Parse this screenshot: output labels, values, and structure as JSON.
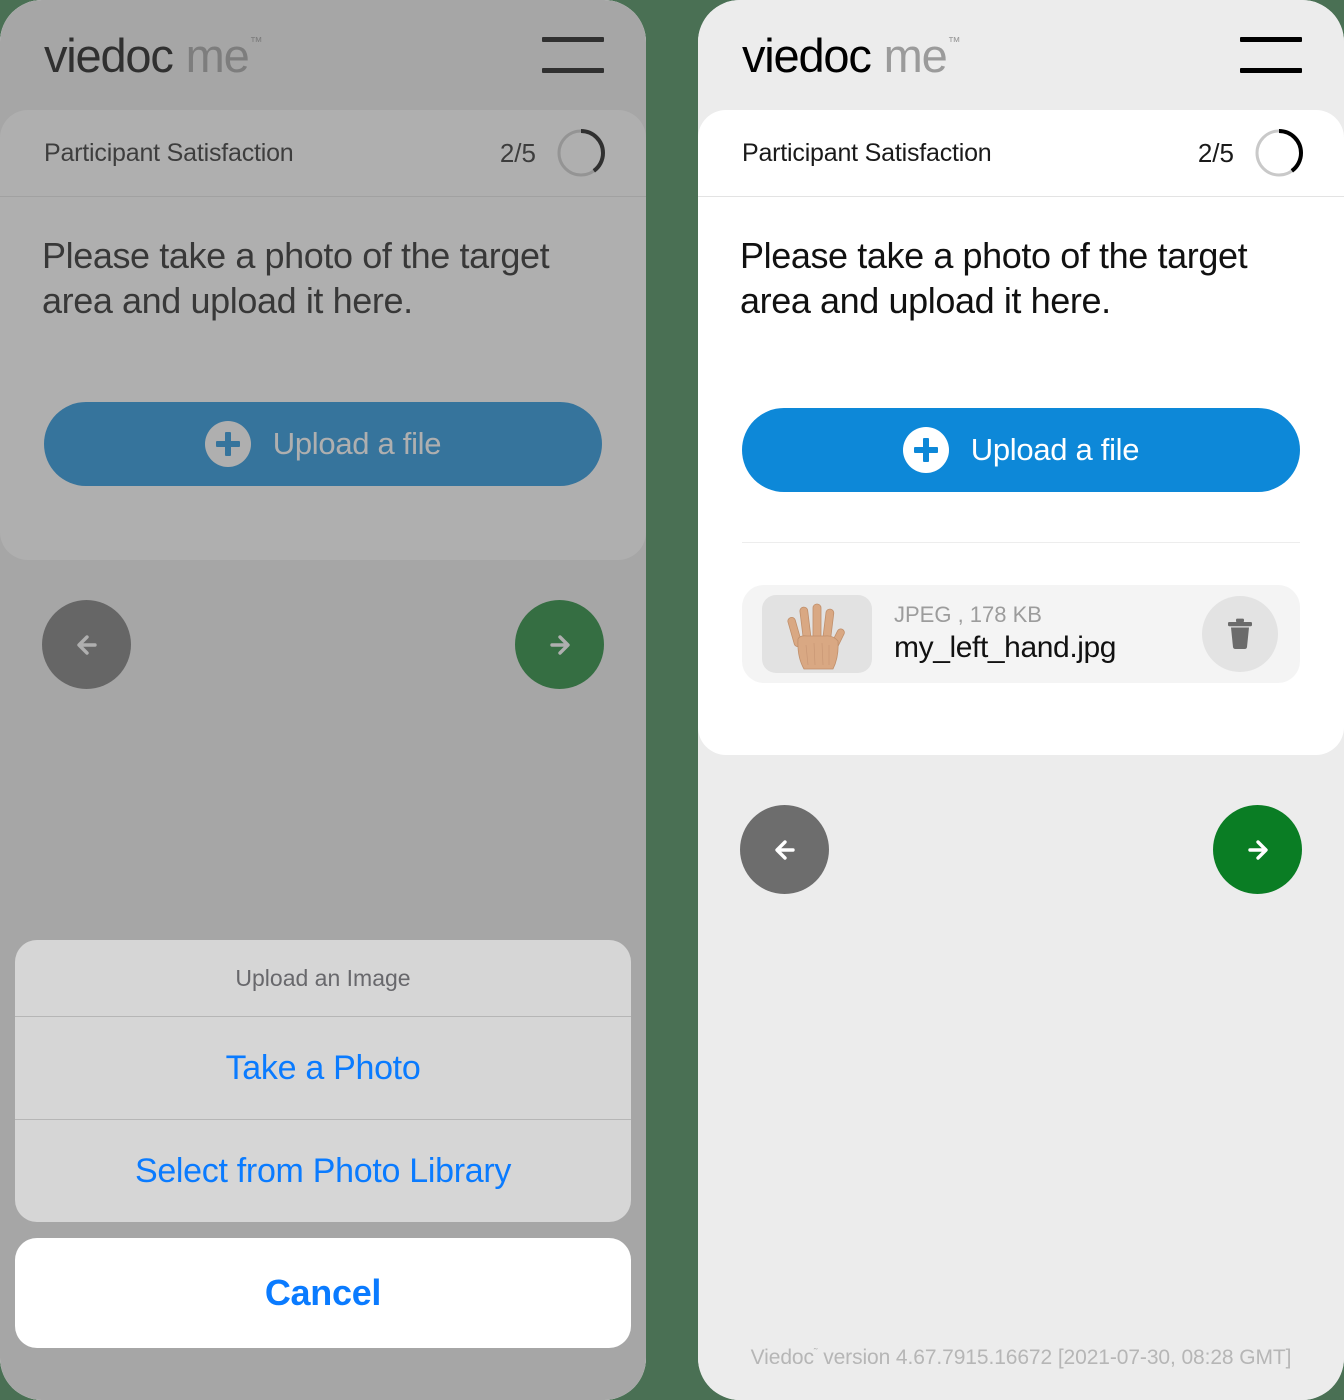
{
  "brand": {
    "name": "viedoc",
    "suffix": "me",
    "trademark": "™"
  },
  "colors": {
    "page_background": "#4a7054",
    "app_background": "#ececec",
    "card_background": "#ffffff",
    "accent_blue": "#0d88d8",
    "ios_blue": "#0a7bff",
    "next_green": "#0a7d24",
    "prev_gray": "#6d6d6d",
    "file_row": "#f4f4f4",
    "sheet_gray": "#d6d6d6"
  },
  "survey": {
    "title": "Participant Satisfaction",
    "progress_label": "2/5",
    "current_step": 2,
    "total_steps": 5,
    "question": "Please take a photo of the target area and upload it here."
  },
  "upload": {
    "button_label": "Upload a file",
    "plus_icon": "plus-circle-icon"
  },
  "file": {
    "type_and_size": "JPEG , 178 KB",
    "name": "my_left_hand.jpg",
    "thumbnail_alt": "hand-photo-thumbnail",
    "delete_icon": "trash-icon"
  },
  "navigation": {
    "previous_icon": "arrow-left-icon",
    "next_icon": "arrow-right-icon",
    "menu_icon": "hamburger-menu-icon"
  },
  "footer": {
    "version_prefix": "Viedoc",
    "version_tm": "˜",
    "version_text": " version 4.67.7915.16672 [2021-07-30, 08:28 GMT]"
  },
  "action_sheet": {
    "title": "Upload an Image",
    "options": [
      {
        "label": "Take a Photo",
        "name": "take-a-photo"
      },
      {
        "label": "Select from Photo Library",
        "name": "select-from-photo-library"
      }
    ],
    "cancel_label": "Cancel"
  }
}
